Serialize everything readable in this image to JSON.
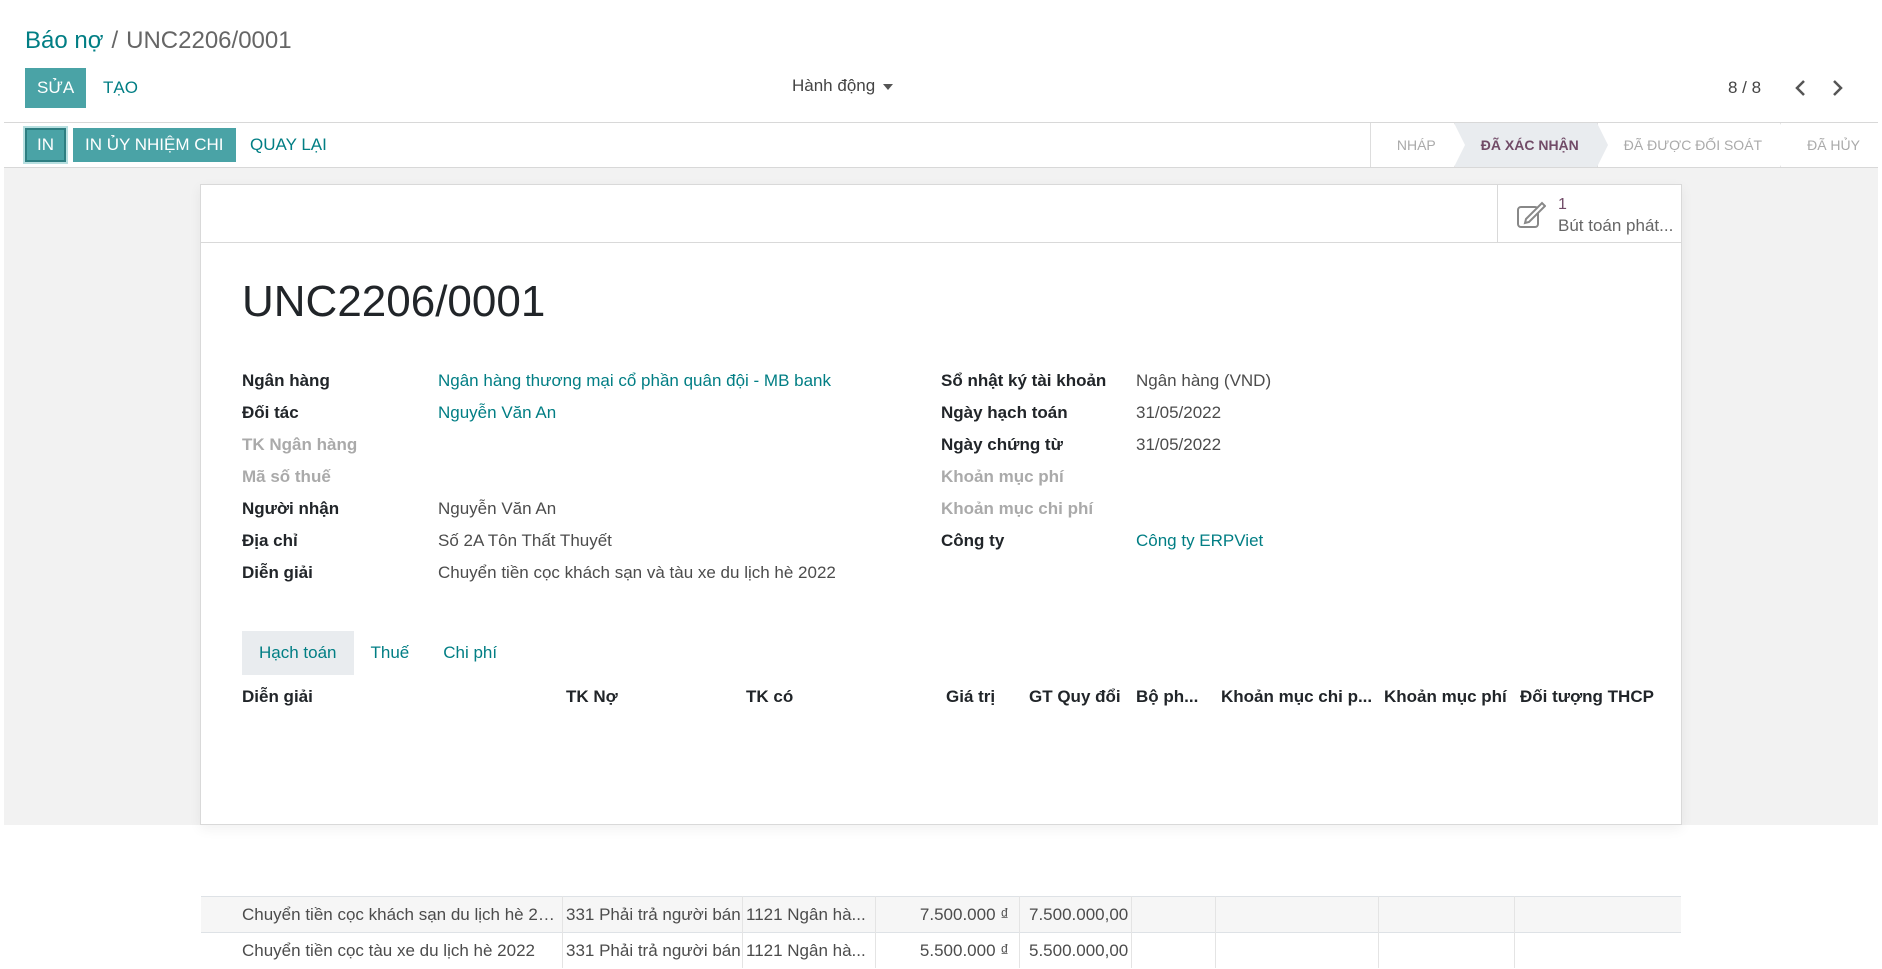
{
  "breadcrumb": {
    "parent": "Báo nợ",
    "separator": "/",
    "current": "UNC2206/0001"
  },
  "toolbar": {
    "edit_label": "SỬA",
    "create_label": "TẠO",
    "actions_label": "Hành động"
  },
  "pager": {
    "value": "8 / 8"
  },
  "statusbar": {
    "print_label": "IN",
    "print_unc_label": "IN ỦY NHIỆM CHI",
    "back_label": "QUAY LẠI",
    "stages": [
      "NHÁP",
      "ĐÃ XÁC NHẬN",
      "ĐÃ ĐƯỢC ĐỐI SOÁT",
      "ĐÃ HỦY"
    ],
    "current_stage": "ĐÃ XÁC NHẬN"
  },
  "smart_button": {
    "count": "1",
    "label": "Bút toán phát..."
  },
  "record": {
    "name": "UNC2206/0001",
    "left": [
      {
        "label": "Ngân hàng",
        "value": "Ngân hàng thương mại cổ phần quân đội - MB bank"
      },
      {
        "label": "Đối tác",
        "value": "Nguyễn Văn An"
      },
      {
        "label": "TK Ngân hàng",
        "value": ""
      },
      {
        "label": "Mã số thuế",
        "value": ""
      },
      {
        "label": "Người nhận",
        "value": "Nguyễn Văn An"
      },
      {
        "label": "Địa chỉ",
        "value": "Số 2A Tôn Thất Thuyết"
      },
      {
        "label": "Diễn giải",
        "value": "Chuyển tiền cọc khách sạn và tàu xe du lịch hè 2022"
      }
    ],
    "right": [
      {
        "label": "Sổ nhật ký tài khoản",
        "value": "Ngân hàng (VND)"
      },
      {
        "label": "Ngày hạch toán",
        "value": "31/05/2022"
      },
      {
        "label": "Ngày chứng từ",
        "value": "31/05/2022"
      },
      {
        "label": "Khoản mục phí",
        "value": ""
      },
      {
        "label": "Khoản mục chi phí",
        "value": ""
      },
      {
        "label": "Công ty",
        "value": "Công ty ERPViet"
      }
    ]
  },
  "tabs": [
    "Hạch toán",
    "Thuế",
    "Chi phí"
  ],
  "table": {
    "headers": [
      "Diễn giải",
      "TK Nợ",
      "TK có",
      "Giá trị",
      "GT Quy đổi",
      "Bộ ph...",
      "Khoản mục chi p...",
      "Khoản mục phí",
      "Đối tượng THCP"
    ],
    "rows": [
      [
        "Chuyển tiền cọc khách sạn du lịch hè 20...",
        "331 Phải trả người bán",
        "1121 Ngân hà...",
        "7.500.000 ₫",
        "7.500.000,00",
        "",
        "",
        "",
        ""
      ],
      [
        "Chuyển tiền cọc tàu xe du lịch hè 2022",
        "331 Phải trả người bán",
        "1121 Ngân hà...",
        "5.500.000 ₫",
        "5.500.000,00",
        "",
        "",
        "",
        ""
      ]
    ]
  },
  "colors": {
    "primary": "#4aa3a6",
    "link": "#017e84",
    "stage_current": "#714b67"
  }
}
